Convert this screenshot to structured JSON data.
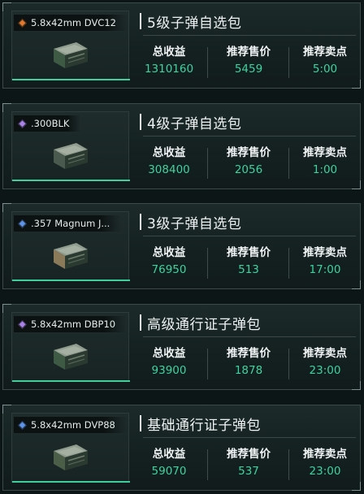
{
  "colors": {
    "accent_green": "#3ecf9a",
    "rarity_orange": "#e0792c",
    "rarity_purple": "#a983e8",
    "rarity_blue": "#5f93e8"
  },
  "stat_labels": {
    "total_income": "总收益",
    "recommended_price": "推荐售价",
    "recommended_time": "推荐卖点"
  },
  "cards": [
    {
      "item_name": "5.8x42mm DVC12",
      "rarity_icon": "orange-diamond-icon",
      "title": "5级子弹自选包",
      "total_income": "1310160",
      "recommended_price": "5459",
      "recommended_time": "5:00",
      "box_color": "#3e5a44"
    },
    {
      "item_name": ".300BLK",
      "rarity_icon": "purple-diamond-icon",
      "title": "4级子弹自选包",
      "total_income": "308400",
      "recommended_price": "2056",
      "recommended_time": "1:00",
      "box_color": "#4a5a4e"
    },
    {
      "item_name": ".357 Magnum J...",
      "rarity_icon": "blue-diamond-icon",
      "title": "3级子弹自选包",
      "total_income": "76950",
      "recommended_price": "513",
      "recommended_time": "17:00",
      "box_color": "#8a7a5a"
    },
    {
      "item_name": "5.8x42mm DBP10",
      "rarity_icon": "purple-diamond-icon",
      "title": "高级通行证子弹包",
      "total_income": "93900",
      "recommended_price": "1878",
      "recommended_time": "23:00",
      "box_color": "#3e5a44"
    },
    {
      "item_name": "5.8x42mm DVP88",
      "rarity_icon": "blue-diamond-icon",
      "title": "基础通行证子弹包",
      "total_income": "59070",
      "recommended_price": "537",
      "recommended_time": "23:00",
      "box_color": "#4a5e48"
    }
  ]
}
